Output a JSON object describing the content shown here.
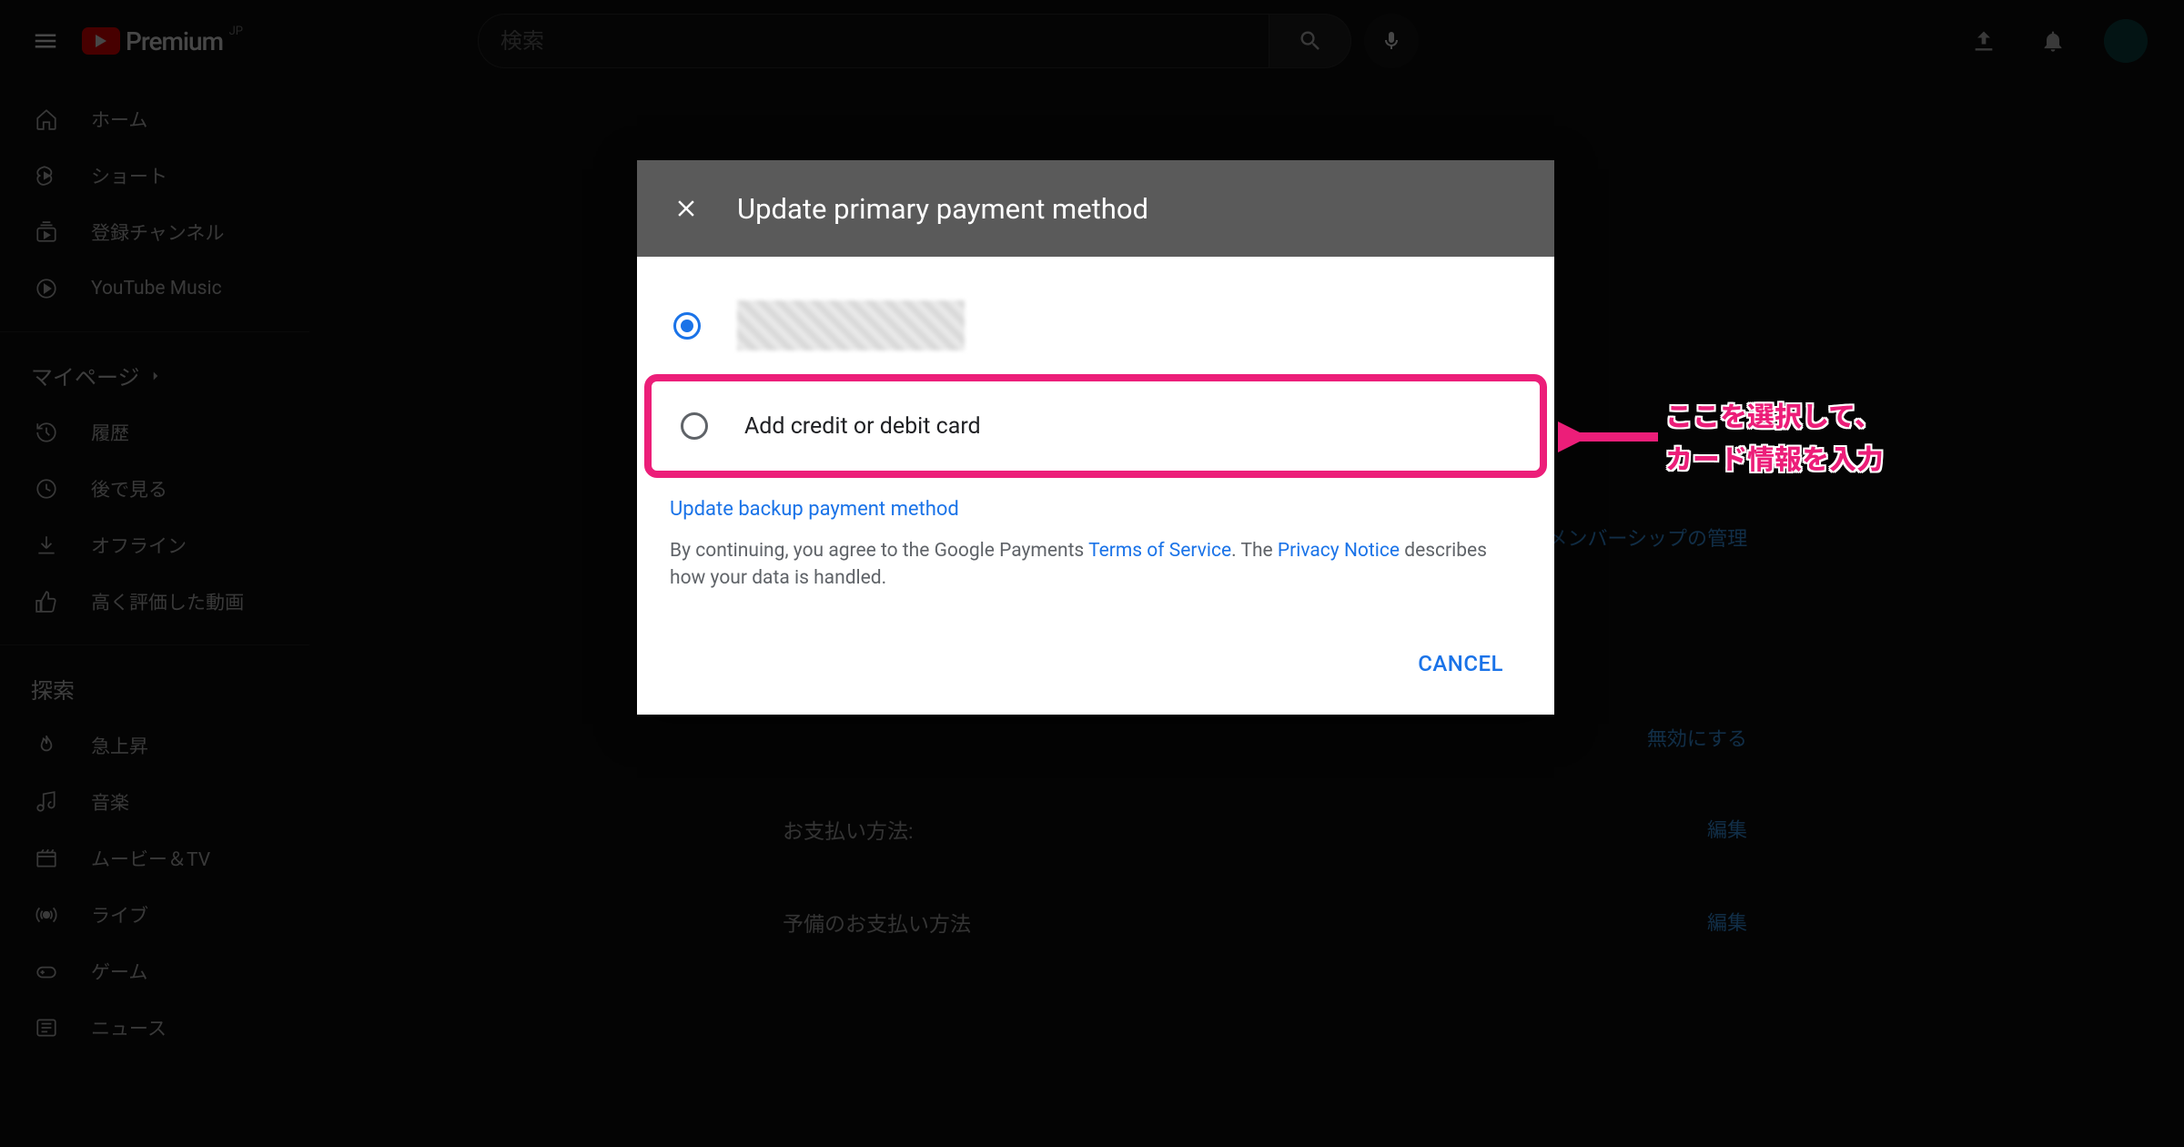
{
  "header": {
    "logo_text": "Premium",
    "logo_sup": "JP",
    "search_placeholder": "検索"
  },
  "sidebar": {
    "items1": [
      {
        "label": "ホーム"
      },
      {
        "label": "ショート"
      },
      {
        "label": "登録チャンネル"
      },
      {
        "label": "YouTube Music"
      }
    ],
    "mypage_head": "マイページ",
    "items2": [
      {
        "label": "履歴"
      },
      {
        "label": "後で見る"
      },
      {
        "label": "オフライン"
      },
      {
        "label": "高く評価した動画"
      }
    ],
    "explore_head": "探索",
    "items3": [
      {
        "label": "急上昇"
      },
      {
        "label": "音楽"
      },
      {
        "label": "ムービー＆TV"
      },
      {
        "label": "ライブ"
      },
      {
        "label": "ゲーム"
      },
      {
        "label": "ニュース"
      }
    ]
  },
  "page": {
    "membership_manage": "メンバーシップの管理",
    "disable": "無効にする",
    "payment_label": "お支払い方法:",
    "backup_label": "予備のお支払い方法",
    "edit": "編集"
  },
  "modal": {
    "title": "Update primary payment method",
    "add_card": "Add credit or debit card",
    "backup_link": "Update backup payment method",
    "legal_pre": "By continuing, you agree to the Google Payments ",
    "tos": "Terms of Service",
    "legal_mid": ". The ",
    "privacy": "Privacy Notice",
    "legal_post": " describes how your data is handled.",
    "cancel": "CANCEL"
  },
  "annotation": {
    "line1": "ここを選択して、",
    "line2": "カード情報を入力"
  }
}
